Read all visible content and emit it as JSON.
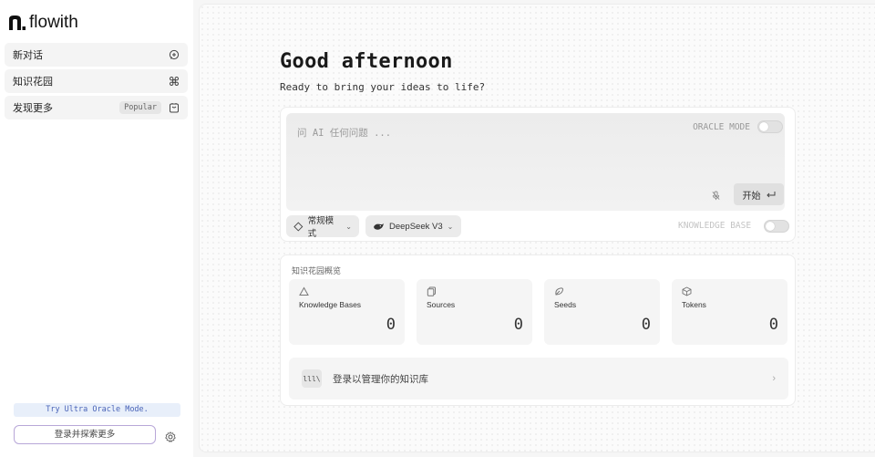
{
  "app": {
    "logo_text": "flowith"
  },
  "sidebar": {
    "items": [
      {
        "label": "新对话",
        "icon": "new-chat-icon"
      },
      {
        "label": "知识花园",
        "icon": "garden-icon"
      },
      {
        "label": "发现更多",
        "icon": "discover-icon",
        "badge": "Popular"
      }
    ],
    "try_banner": "Try Ultra Oracle Mode.",
    "login_button": "登录并探索更多",
    "settings_icon": "gear-icon"
  },
  "main": {
    "greeting": "Good afternoon",
    "subtitle": "Ready to bring your ideas to life?",
    "chat": {
      "placeholder": "问 AI 任何问题 ...",
      "oracle_mode_label": "ORACLE MODE",
      "oracle_mode_on": false,
      "start_button": "开始",
      "mode_chip": "常规模式",
      "model_chip": "DeepSeek V3",
      "knowledge_base_label": "KNOWLEDGE BASE",
      "knowledge_base_on": false
    },
    "kb_overview": {
      "title": "知识花园概览",
      "stats": [
        {
          "label": "Knowledge Bases",
          "value": "0",
          "icon": "triangle-icon"
        },
        {
          "label": "Sources",
          "value": "0",
          "icon": "copy-icon"
        },
        {
          "label": "Seeds",
          "value": "0",
          "icon": "seed-icon"
        },
        {
          "label": "Tokens",
          "value": "0",
          "icon": "cube-icon"
        }
      ],
      "login_row": {
        "icon_text": "lll\\",
        "text": "登录以管理你的知识库"
      }
    }
  },
  "colors": {
    "accent_banner_bg": "#e8effa",
    "accent_banner_text": "#4a64b8",
    "login_border": "#b8a7d8"
  }
}
